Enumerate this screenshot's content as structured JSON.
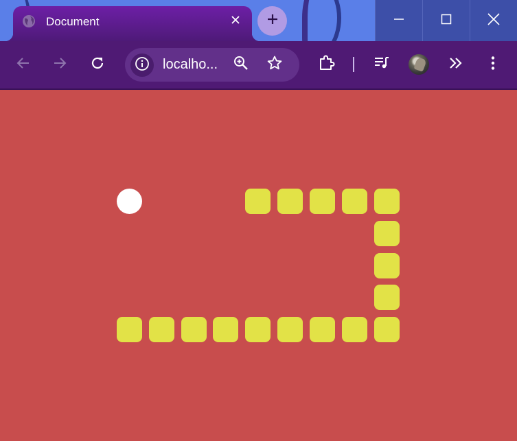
{
  "browser": {
    "tab": {
      "title": "Document",
      "favicon": "globe-icon",
      "close_icon": "close-icon"
    },
    "new_tab_icon": "plus-icon",
    "window_controls": [
      "minimize-icon",
      "maximize-icon",
      "close-icon"
    ],
    "toolbar": {
      "back_icon": "arrow-left-icon",
      "forward_icon": "arrow-right-icon",
      "reload_icon": "reload-icon",
      "site_info_icon": "info-icon",
      "url": "localho...",
      "zoom_icon": "zoom-in-icon",
      "bookmark_icon": "star-icon",
      "extensions_icon": "puzzle-icon",
      "media_icon": "playlist-icon",
      "profile": "avatar",
      "overflow_icon": "chevron-double-right-icon",
      "menu_icon": "kebab-menu-icon"
    }
  },
  "game": {
    "background_color": "#c84d4d",
    "snake_color": "#e2e247",
    "food_color": "#ffffff",
    "grid": {
      "cols": 16,
      "rows": 11
    },
    "food": {
      "col": 3,
      "row": 3
    },
    "snake": [
      {
        "col": 7,
        "row": 3
      },
      {
        "col": 8,
        "row": 3
      },
      {
        "col": 9,
        "row": 3
      },
      {
        "col": 10,
        "row": 3
      },
      {
        "col": 11,
        "row": 3
      },
      {
        "col": 11,
        "row": 4
      },
      {
        "col": 11,
        "row": 5
      },
      {
        "col": 11,
        "row": 6
      },
      {
        "col": 11,
        "row": 7
      },
      {
        "col": 10,
        "row": 7
      },
      {
        "col": 9,
        "row": 7
      },
      {
        "col": 8,
        "row": 7
      },
      {
        "col": 7,
        "row": 7
      },
      {
        "col": 6,
        "row": 7
      },
      {
        "col": 5,
        "row": 7
      },
      {
        "col": 4,
        "row": 7
      },
      {
        "col": 3,
        "row": 7
      }
    ]
  }
}
